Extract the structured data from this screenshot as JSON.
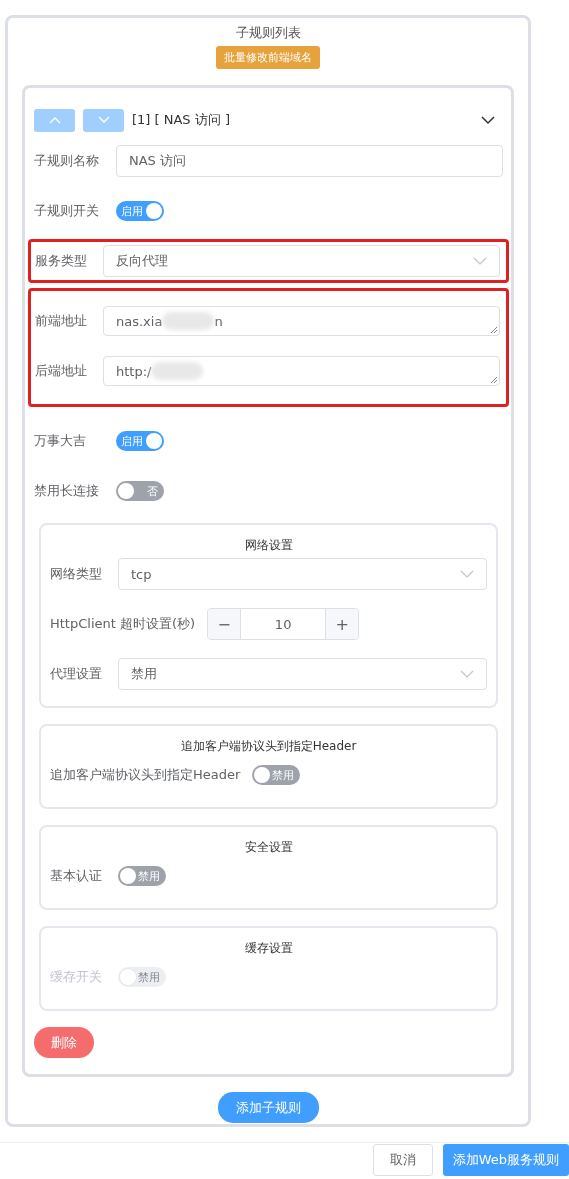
{
  "title": "子规则列表",
  "batch_button": "批量修改前端域名",
  "rule": {
    "heading": "[1] [ NAS 访问 ]",
    "expanded": true,
    "fields": [
      {
        "kind": "input",
        "label": "子规则名称",
        "value": "NAS 访问"
      },
      {
        "kind": "switch",
        "label": "子规则开关",
        "on": true,
        "text": "启用"
      },
      {
        "kind": "group",
        "highlighted": true,
        "fields": [
          {
            "kind": "select",
            "label": "服务类型",
            "value": "反向代理"
          }
        ]
      },
      {
        "kind": "group",
        "highlighted": true,
        "fields": [
          {
            "kind": "textarea",
            "label": "前端地址",
            "value": "nas.xia",
            "value_end": "n"
          },
          {
            "kind": "textarea",
            "label": "后端地址",
            "value": "http:/"
          }
        ]
      },
      {
        "kind": "switch",
        "label": "万事大吉",
        "on": true,
        "text": "启用"
      },
      {
        "kind": "switch",
        "label": "禁用长连接",
        "on": false,
        "text": "否"
      }
    ],
    "sections": [
      {
        "title": "网络设置",
        "fields": [
          {
            "kind": "select",
            "label": "网络类型",
            "value": "tcp"
          },
          {
            "kind": "number",
            "label": "HttpClient 超时设置(秒)",
            "value": "10",
            "minus": "−",
            "plus": "+"
          },
          {
            "kind": "select",
            "label": "代理设置",
            "value": "禁用"
          }
        ]
      },
      {
        "title": "追加客户端协议头到指定Header",
        "fields": [
          {
            "kind": "switch",
            "label": "追加客户端协议头到指定Header",
            "on": false,
            "text": "禁用"
          }
        ]
      },
      {
        "title": "安全设置",
        "fields": [
          {
            "kind": "switch",
            "label": "基本认证",
            "on": false,
            "text": "禁用"
          }
        ]
      },
      {
        "title": "缓存设置",
        "fields": [
          {
            "kind": "switch",
            "label": "缓存开关",
            "on": false,
            "text": "禁用",
            "disabled": true
          }
        ]
      }
    ],
    "delete_button": "删除"
  },
  "add_button": "添加子规则",
  "footer": {
    "cancel": "取消",
    "confirm": "添加Web服务规则"
  }
}
